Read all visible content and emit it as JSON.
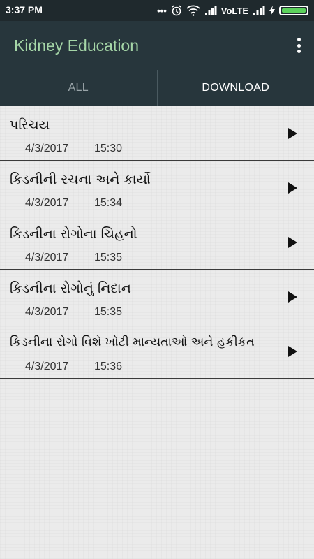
{
  "status_bar": {
    "time": "3:37 PM",
    "indicators": [
      "more-dots-icon",
      "alarm-icon",
      "wifi-icon",
      "signal-icon",
      "signal-icon",
      "charging-icon",
      "battery-icon"
    ],
    "volte": "VoLTE"
  },
  "app_bar": {
    "title": "Kidney Education",
    "title_color": "#a5d6a7",
    "background": "#27363c"
  },
  "tabs": [
    {
      "label": "ALL",
      "selected": false
    },
    {
      "label": "DOWNLOAD",
      "selected": true
    }
  ],
  "list": [
    {
      "title": "પરિચય",
      "date": "4/3/2017",
      "time": "15:30"
    },
    {
      "title": "કિડનીની રચના અને કાર્યો",
      "date": "4/3/2017",
      "time": "15:34"
    },
    {
      "title": "કિડનીના રોગોના ચિહનો",
      "date": "4/3/2017",
      "time": "15:35"
    },
    {
      "title": "કિડનીના રોગોનું નિદાન",
      "date": "4/3/2017",
      "time": "15:35"
    },
    {
      "title": "કિડનીના રોગો વિશે ખોટી માન્યતાઓ અને હકીકત",
      "date": "4/3/2017",
      "time": "15:36"
    }
  ]
}
